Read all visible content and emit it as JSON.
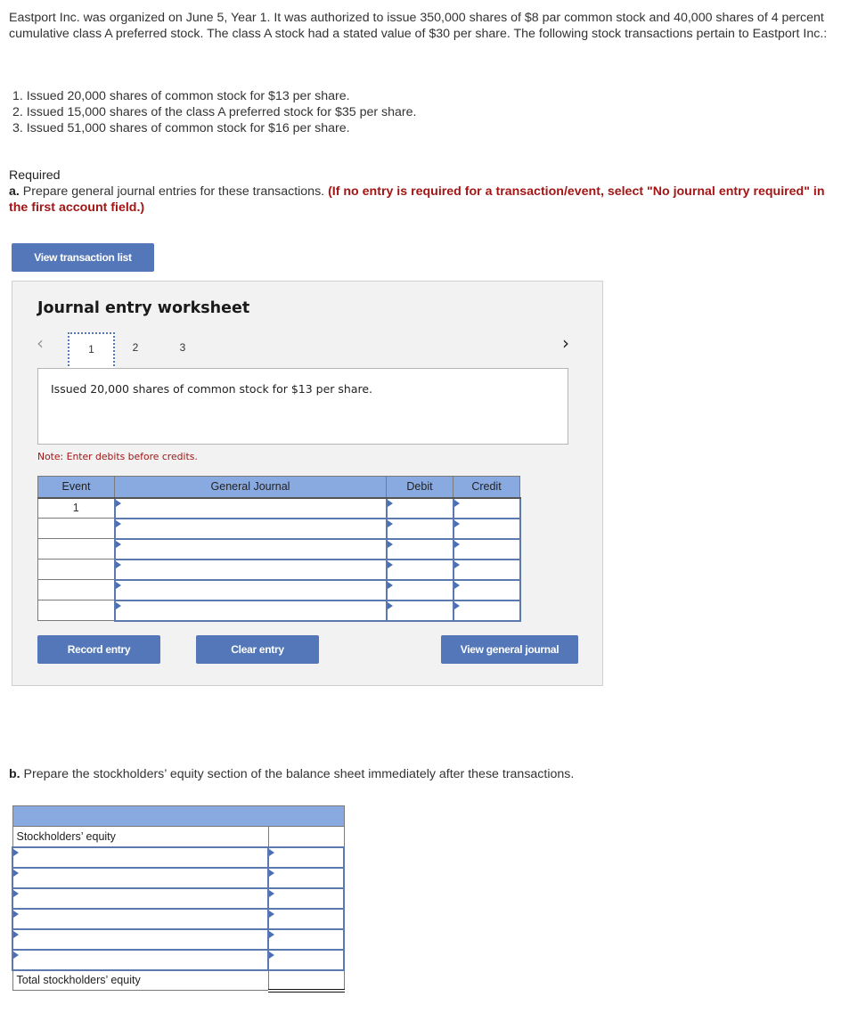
{
  "problem": {
    "intro": "Eastport Inc. was organized on June 5, Year 1. It was authorized to issue 350,000 shares of $8 par common stock and 40,000 shares of 4 percent cumulative class A preferred stock. The class A stock had a stated value of $30 per share. The following stock transactions pertain to Eastport Inc.:",
    "transactions": [
      "1. Issued 20,000 shares of common stock for $13 per share.",
      "2. Issued 15,000 shares of the class A preferred stock for $35 per share.",
      "3. Issued 51,000 shares of common stock for $16 per share."
    ],
    "required_label": "Required",
    "part_a_letter": "a.",
    "part_a_text": " Prepare general journal entries for these transactions. ",
    "part_a_note": "(If no entry is required for a transaction/event, select \"No journal entry required\" in the first account field.)",
    "part_b_letter": "b.",
    "part_b_text": " Prepare the stockholders’ equity section of the balance sheet immediately after these transactions."
  },
  "buttons": {
    "view_transaction_list": "View transaction list",
    "record_entry": "Record entry",
    "clear_entry": "Clear entry",
    "view_general_journal": "View general journal"
  },
  "worksheet": {
    "title": "Journal entry worksheet",
    "nav_prev": "‹",
    "nav_next": "›",
    "tabs": [
      "1",
      "2",
      "3"
    ],
    "active_tab": "1",
    "description": "Issued 20,000 shares of common stock for $13 per share.",
    "note": "Note: Enter debits before credits.",
    "columns": [
      "Event",
      "General Journal",
      "Debit",
      "Credit"
    ],
    "rows": [
      {
        "event": "1",
        "account": "",
        "debit": "",
        "credit": ""
      },
      {
        "event": "",
        "account": "",
        "debit": "",
        "credit": ""
      },
      {
        "event": "",
        "account": "",
        "debit": "",
        "credit": ""
      },
      {
        "event": "",
        "account": "",
        "debit": "",
        "credit": ""
      },
      {
        "event": "",
        "account": "",
        "debit": "",
        "credit": ""
      },
      {
        "event": "",
        "account": "",
        "debit": "",
        "credit": ""
      }
    ]
  },
  "equity_section": {
    "heading_label": "Stockholders’ equity",
    "total_label": "Total stockholders’ equity",
    "rows": [
      {
        "label": "",
        "amount": ""
      },
      {
        "label": "",
        "amount": ""
      },
      {
        "label": "",
        "amount": ""
      },
      {
        "label": "",
        "amount": ""
      },
      {
        "label": "",
        "amount": ""
      },
      {
        "label": "",
        "amount": ""
      }
    ]
  },
  "colors": {
    "button_blue": "#5377b8",
    "header_blue": "#89aae0",
    "instruction_red": "#a31515"
  }
}
